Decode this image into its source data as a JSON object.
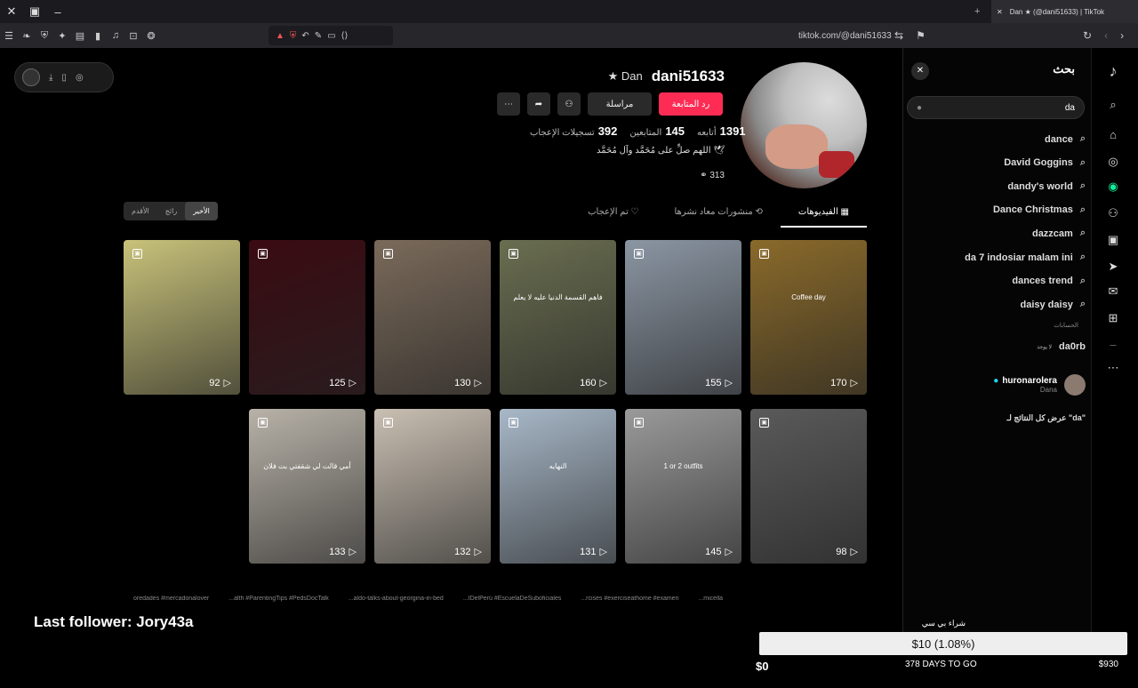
{
  "window": {
    "tab_title": "Dan ★ (@dani51633) | TikTok"
  },
  "nav": {
    "url": "tiktok.com/@dani51633"
  },
  "profile": {
    "username": "dani51633",
    "display_name": "Dan",
    "buttons": {
      "primary": "رد المتابعة",
      "message": "مراسلة"
    },
    "stats": [
      {
        "value": "1391",
        "label": "أتابعه"
      },
      {
        "value": "145",
        "label": "المتابعين"
      },
      {
        "value": "392",
        "label": "تسجيلات الإعجاب"
      }
    ],
    "bio": "اللهم صلِّ على مُحَمَّد وآل مُحَمَّد 🕊",
    "link": "313"
  },
  "tabs": [
    "الفيديوهات",
    "منشورات معاد نشرها",
    "تم الإعجاب"
  ],
  "sort": [
    "الأخير",
    "رائج",
    "الأقدم"
  ],
  "videos": [
    {
      "views": "92",
      "color": "#c8c27a"
    },
    {
      "views": "125",
      "color": "#3a0b12"
    },
    {
      "views": "130",
      "color": "#7a6a5a"
    },
    {
      "views": "160",
      "color": "#6a6e50",
      "caption": "فاهم القسمة الدنيا عليه لا يعلم"
    },
    {
      "views": "155",
      "color": "#8b96a3",
      "caption": ""
    },
    {
      "views": "170",
      "color": "#8a6a2a",
      "caption": "Coffee day"
    },
    {
      "views": "133",
      "color": "#b8b2a8",
      "caption": "أمي قالت لي شقفتي بت فلان"
    },
    {
      "views": "132",
      "color": "#c9bfb2"
    },
    {
      "views": "131",
      "color": "#a8b8c8",
      "caption": "النهايه"
    },
    {
      "views": "145",
      "color": "#9a9a9a",
      "caption": "1 or 2 outfits"
    },
    {
      "views": "98",
      "color": "#5a5a5a"
    }
  ],
  "hashtags": [
    "oredades #mercadonalover",
    "...alth #ParentingTips #PedsDocTalk",
    "...aldo-talks-about-georgina-in-bed",
    "...IDelPerú #EscuelaDeSuboficiales",
    "...rcises #exerciseathome #examen",
    "...micella"
  ],
  "overlay": {
    "follower": "Last follower: Jory43a"
  },
  "search": {
    "title": "بحث",
    "query": "da",
    "suggestions": [
      "dance",
      "David Goggins",
      "dandy's world",
      "Dance Christmas",
      "dazzcam",
      "da 7 indosiar malam ini",
      "dances trend",
      "daisy daisy"
    ],
    "accounts_label": "الحسابات",
    "account_plain": "da0rb",
    "account_plain_sub": "لا يوجد",
    "account": {
      "name": "huronarolera",
      "sub": "Dana"
    },
    "see_all": "عرض كل النتائج لـ \"da\""
  },
  "goal": {
    "title": "شراء بي سي",
    "progress_text": "$10 (1.08%)",
    "progress": 1.08,
    "start": "$0",
    "end": "$930",
    "days": "378 DAYS TO GO"
  }
}
